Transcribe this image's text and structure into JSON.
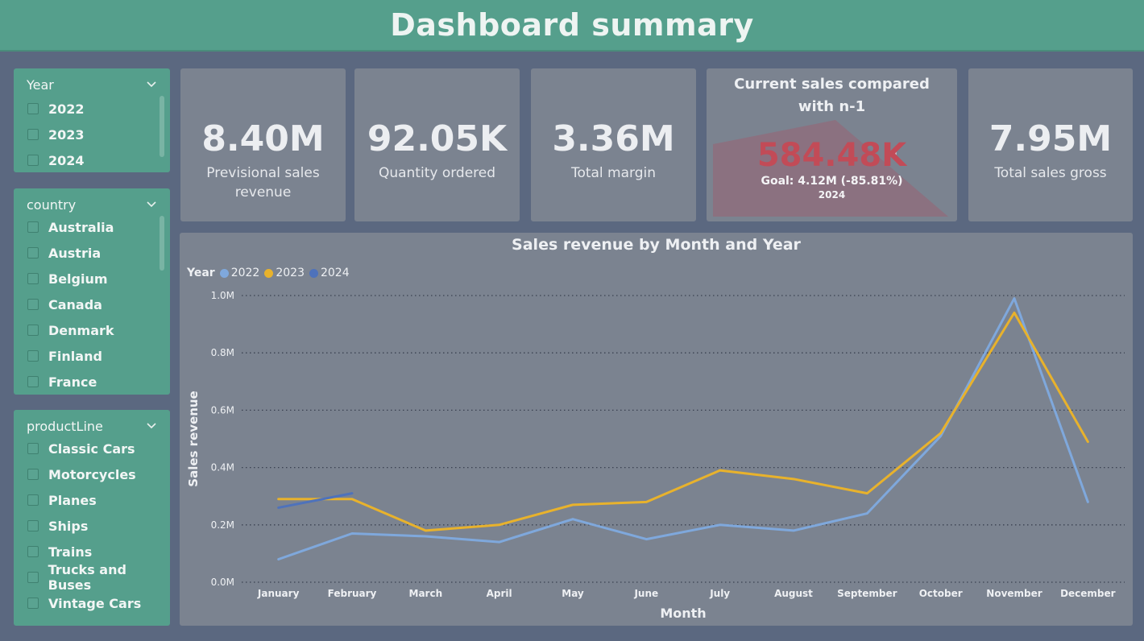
{
  "header": {
    "title": "Dashboard summary"
  },
  "slicers": {
    "year": {
      "title": "Year",
      "options": [
        "2022",
        "2023",
        "2024"
      ]
    },
    "country": {
      "title": "country",
      "options": [
        "Australia",
        "Austria",
        "Belgium",
        "Canada",
        "Denmark",
        "Finland",
        "France"
      ]
    },
    "productLine": {
      "title": "productLine",
      "options": [
        "Classic Cars",
        "Motorcycles",
        "Planes",
        "Ships",
        "Trains",
        "Trucks and Buses",
        "Vintage Cars"
      ]
    }
  },
  "cards": {
    "previsional": {
      "value": "8.40M",
      "label": "Previsional sales revenue"
    },
    "quantity": {
      "value": "92.05K",
      "label": "Quantity ordered"
    },
    "margin": {
      "value": "3.36M",
      "label": "Total margin"
    },
    "gauge": {
      "title": "Current sales compared with n-1",
      "value": "584.48K",
      "goal": "Goal: 4.12M (-85.81%)",
      "year": "2024"
    },
    "gross": {
      "value": "7.95M",
      "label": "Total sales gross"
    }
  },
  "colors": {
    "y2022": "#7fa8dc",
    "y2023": "#e8b22c",
    "y2024": "#4e72bb",
    "header": "#559f8c",
    "gaugeRed": "#c24b57"
  },
  "chart_data": {
    "type": "line",
    "title": "Sales revenue by Month and Year",
    "xlabel": "Month",
    "ylabel": "Sales revenue",
    "legend_title": "Year",
    "legend_position": "top-left",
    "categories": [
      "January",
      "February",
      "March",
      "April",
      "May",
      "June",
      "July",
      "August",
      "September",
      "October",
      "November",
      "December"
    ],
    "yticks": [
      "0.0M",
      "0.2M",
      "0.4M",
      "0.6M",
      "0.8M",
      "1.0M"
    ],
    "ylim": [
      0,
      1.0
    ],
    "grid": true,
    "series": [
      {
        "name": "2022",
        "values": [
          0.08,
          0.17,
          0.16,
          0.14,
          0.22,
          0.15,
          0.2,
          0.18,
          0.24,
          0.51,
          0.99,
          0.28
        ]
      },
      {
        "name": "2023",
        "values": [
          0.29,
          0.29,
          0.18,
          0.2,
          0.27,
          0.28,
          0.39,
          0.36,
          0.31,
          0.52,
          0.94,
          0.49
        ]
      },
      {
        "name": "2024",
        "values": [
          0.26,
          0.31
        ]
      }
    ]
  }
}
